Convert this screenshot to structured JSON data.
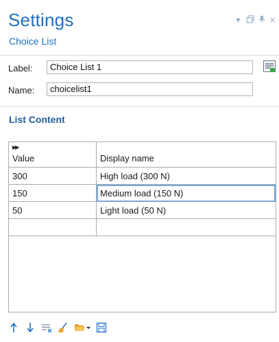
{
  "header": {
    "title": "Settings",
    "subtitle": "Choice List"
  },
  "form": {
    "label_caption": "Label:",
    "label_value": "Choice List 1",
    "name_caption": "Name:",
    "name_value": "choicelist1"
  },
  "list": {
    "section_title": "List Content",
    "columns": [
      "Value",
      "Display name"
    ],
    "rows": [
      {
        "value": "300",
        "display": "High load (300 N)"
      },
      {
        "value": "150",
        "display": "Medium load (150 N)"
      },
      {
        "value": "50",
        "display": "Light load (50 N)"
      },
      {
        "value": "",
        "display": ""
      }
    ]
  },
  "toolbar": {
    "icons": [
      "move-up-icon",
      "move-down-icon",
      "delete-icon",
      "clear-table-icon",
      "load-from-file-icon",
      "save-to-file-icon"
    ]
  },
  "colors": {
    "accent": "#1f6fc0",
    "section": "#1f5d9c",
    "selection": "#7aa7d6"
  }
}
